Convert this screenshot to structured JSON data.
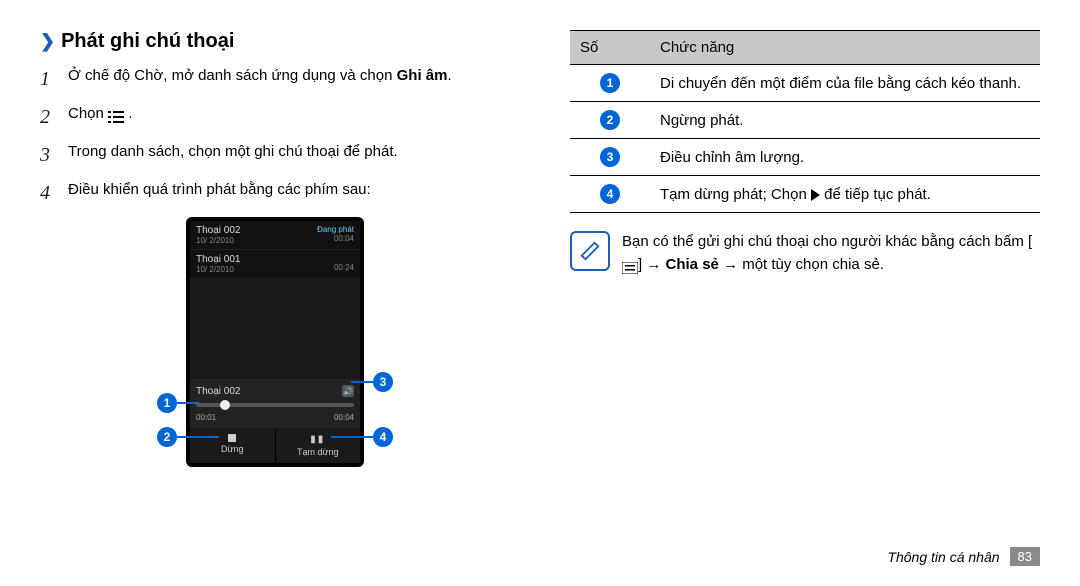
{
  "heading": "Phát ghi chú thoại",
  "steps": [
    {
      "n": "1",
      "pre": "Ở chế độ Chờ, mở danh sách ứng dụng và chọn ",
      "bold": "Ghi âm",
      "post": "."
    },
    {
      "n": "2",
      "pre": "Chọn ",
      "icon": "list",
      "post": "."
    },
    {
      "n": "3",
      "text": "Trong danh sách, chọn một ghi chú thoại để phát."
    },
    {
      "n": "4",
      "text": "Điều khiển quá trình phát bằng các phím sau:"
    }
  ],
  "phone": {
    "row1": {
      "title": "Thoại 002",
      "status": "Đang phát",
      "date": "10/ 2/2010",
      "time": "00:04"
    },
    "row2": {
      "title": "Thoại 001",
      "date": "10/ 2/2010",
      "time": "00:24"
    },
    "player": {
      "track": "Thoại 002",
      "t1": "00:01",
      "t2": "00:04"
    },
    "btn_stop": "Dừng",
    "btn_pause": "Tạm dừng"
  },
  "callouts": {
    "c1": "1",
    "c2": "2",
    "c3": "3",
    "c4": "4"
  },
  "table": {
    "h1": "Số",
    "h2": "Chức năng",
    "rows": [
      {
        "n": "1",
        "t": "Di chuyển đến một điểm của file bằng cách kéo thanh."
      },
      {
        "n": "2",
        "t": "Ngừng phát."
      },
      {
        "n": "3",
        "t": "Điều chỉnh âm lượng."
      },
      {
        "n": "4",
        "pre": "Tạm dừng phát; Chọn ",
        "post": " để tiếp tục phát."
      }
    ]
  },
  "note": {
    "line1_pre": "Bạn có thể gửi ghi chú thoại cho người khác bằng cách bấm [",
    "line1_mid": "] → ",
    "bold": "Chia sẻ",
    "line1_post": " → một tùy chọn chia sẻ."
  },
  "footer": {
    "section": "Thông tin cá nhân",
    "page": "83"
  }
}
